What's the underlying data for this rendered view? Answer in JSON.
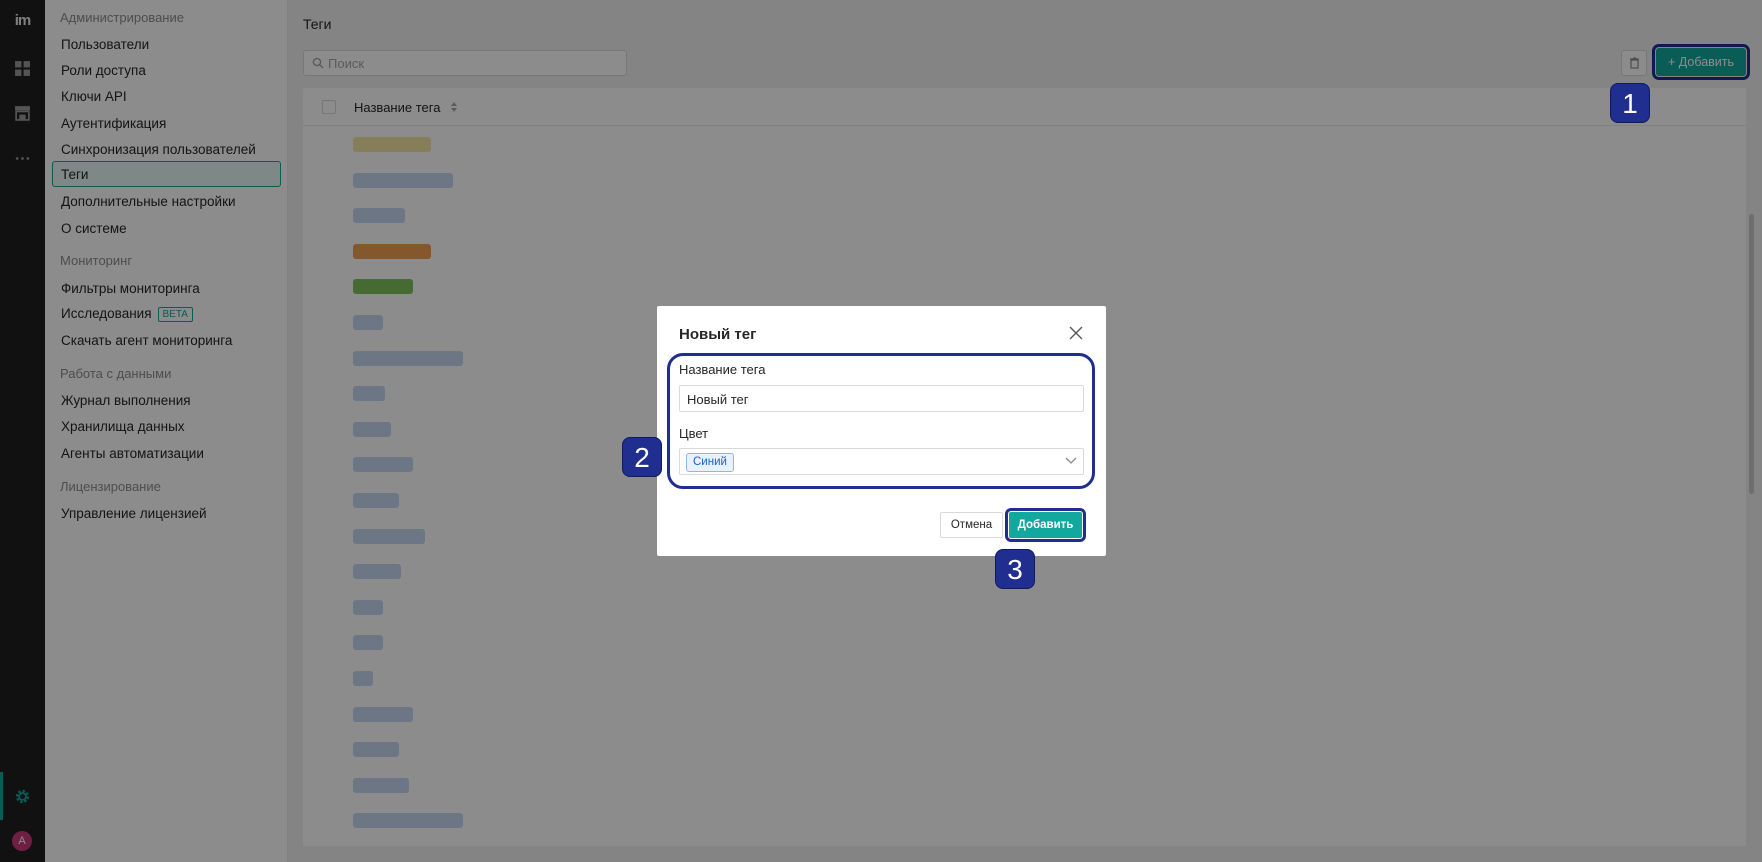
{
  "app": {
    "logo_text": "im"
  },
  "rail": {
    "icons": [
      "dashboard-icon",
      "storefront-icon",
      "more-icon",
      "settings-icon"
    ],
    "avatar_letter": "A"
  },
  "sidebar": {
    "sections": [
      {
        "title": "Администрирование",
        "items": [
          "Пользователи",
          "Роли доступа",
          "Ключи API",
          "Аутентификация",
          "Синхронизация пользователей",
          "Теги",
          "Дополнительные настройки",
          "О системе"
        ]
      },
      {
        "title": "Мониторинг",
        "items": [
          "Фильтры мониторинга",
          "Исследования",
          "Скачать агент мониторинга"
        ],
        "badge": "BETA"
      },
      {
        "title": "Работа с данными",
        "items": [
          "Журнал выполнения",
          "Хранилища данных",
          "Агенты автоматизации"
        ]
      },
      {
        "title": "Лицензирование",
        "items": [
          "Управление лицензией"
        ]
      }
    ],
    "active_item": "Теги"
  },
  "main": {
    "title": "Теги",
    "search_placeholder": "Поиск",
    "add_button_label": "+ Добавить",
    "table": {
      "column_header": "Название тега",
      "row_chip_colors": [
        "#f3e6a0",
        "#c5d8f2",
        "#c5d8f2",
        "#f0a050",
        "#7fc45c",
        "#c5d8f2",
        "#c5d8f2",
        "#c5d8f2",
        "#c5d8f2",
        "#c5d8f2",
        "#c5d8f2",
        "#c5d8f2",
        "#c5d8f2",
        "#c5d8f2",
        "#c5d8f2",
        "#c5d8f2",
        "#c5d8f2",
        "#c5d8f2",
        "#c5d8f2",
        "#c5d8f2"
      ]
    }
  },
  "dialog": {
    "title": "Новый тег",
    "name_label": "Название тега",
    "name_value": "Новый тег",
    "color_label": "Цвет",
    "color_value": "Синий",
    "cancel_label": "Отмена",
    "submit_label": "Добавить"
  },
  "steps": {
    "one": "1",
    "two": "2",
    "three": "3"
  },
  "colors": {
    "accent": "#13a89e",
    "step_marker": "#1f2e8f",
    "tag_blue": "#1c63c4"
  }
}
